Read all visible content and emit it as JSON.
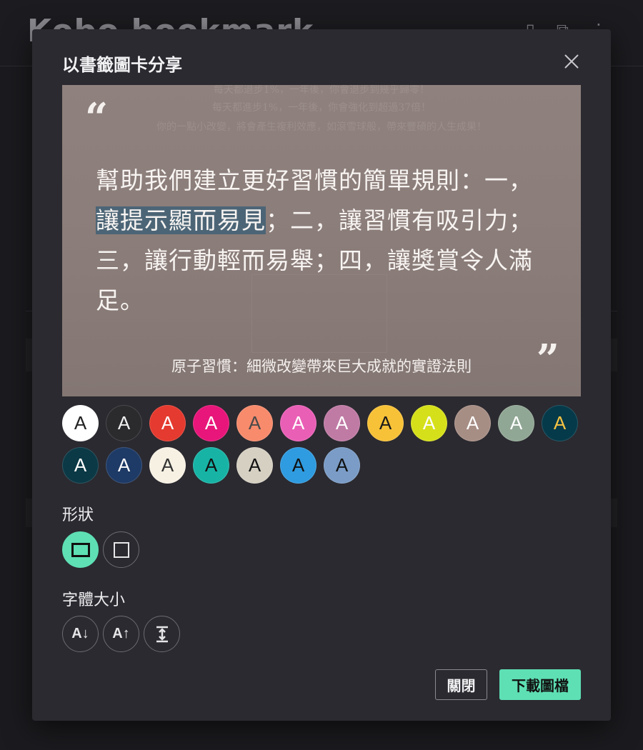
{
  "background": {
    "app_title": "Kobo bookmark"
  },
  "dialog": {
    "title": "以書籤圖卡分享",
    "quote": {
      "before_highlight": "幫助我們建立更好習慣的簡單規則：一，",
      "highlight": "讓提示顯而易見",
      "after_highlight": "；二，讓習慣有吸引力；三，讓行動輕而易舉；四，讓獎賞令人滿足。",
      "open_mark": "“",
      "close_mark": "”"
    },
    "book_title": "原子習慣：細微改變帶來巨大成就的實證法則",
    "background_faint_text": [
      "每天都退步1%，一年後，你會退步到幾乎歸零！",
      "每天都進步1%，一年後，你會強化到超過37倍！",
      "你的一點小改變，將會產生複利效應，如滾雪球般，帶來豐碩的人生成果！"
    ],
    "swatches": [
      {
        "letter": "A",
        "bg": "#ffffff",
        "fg": "#222222"
      },
      {
        "letter": "A",
        "bg": "#2b2b2e",
        "fg": "#f0f0f0"
      },
      {
        "letter": "A",
        "bg": "#e53a2f",
        "fg": "#ffffff"
      },
      {
        "letter": "A",
        "bg": "#e8167a",
        "fg": "#ffffff"
      },
      {
        "letter": "A",
        "bg": "#f78b6c",
        "fg": "#4a4a4a"
      },
      {
        "letter": "A",
        "bg": "#ea5fb6",
        "fg": "#ffffff"
      },
      {
        "letter": "A",
        "bg": "#c07ba5",
        "fg": "#ffffff"
      },
      {
        "letter": "A",
        "bg": "#f7c138",
        "fg": "#1a1a1a"
      },
      {
        "letter": "A",
        "bg": "#d6e01a",
        "fg": "#ffffff"
      },
      {
        "letter": "A",
        "bg": "#a78e85",
        "fg": "#ffffff"
      },
      {
        "letter": "A",
        "bg": "#91a795",
        "fg": "#ffffff"
      },
      {
        "letter": "A",
        "bg": "#053a4a",
        "fg": "#f6c343"
      },
      {
        "letter": "A",
        "bg": "#0b3946",
        "fg": "#ffffff"
      },
      {
        "letter": "A",
        "bg": "#1e3a66",
        "fg": "#ffffff"
      },
      {
        "letter": "A",
        "bg": "#f7f1e4",
        "fg": "#333333"
      },
      {
        "letter": "A",
        "bg": "#17b4a6",
        "fg": "#111111"
      },
      {
        "letter": "A",
        "bg": "#d5d0c2",
        "fg": "#111111"
      },
      {
        "letter": "A",
        "bg": "#2f9be0",
        "fg": "#111111"
      },
      {
        "letter": "A",
        "bg": "#7a9cc6",
        "fg": "#111111"
      }
    ],
    "shape_label": "形狀",
    "font_size_label": "字體大小",
    "font_buttons": {
      "decrease": "A↓",
      "increase": "A↑",
      "fit": "↕"
    },
    "close_button": "關閉",
    "download_button": "下載圖檔"
  }
}
